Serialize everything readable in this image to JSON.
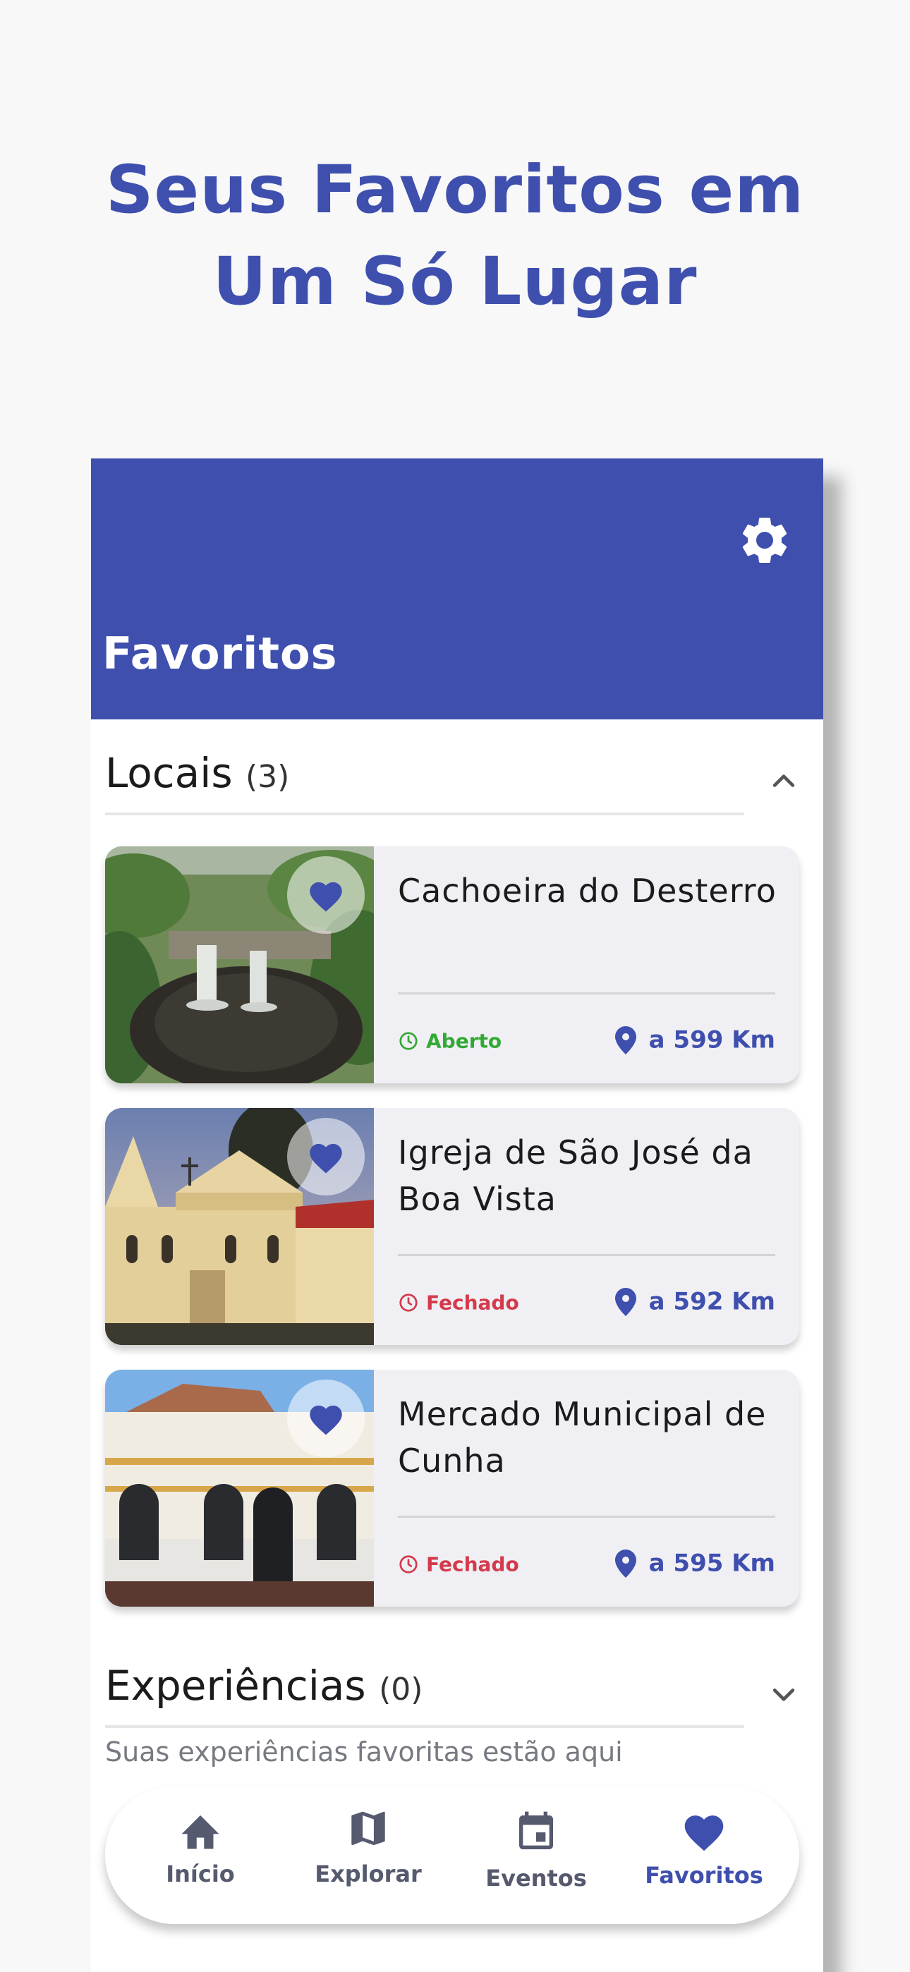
{
  "headline": {
    "line1": "Seus Favoritos em",
    "line2": "Um Só Lugar"
  },
  "app": {
    "title": "Favoritos",
    "settings_icon": "gear-icon"
  },
  "sections": {
    "locais": {
      "title": "Locais",
      "count": "(3)",
      "state": "expanded"
    },
    "experiencias": {
      "title": "Experiências",
      "count": "(0)",
      "state": "collapsed",
      "subtitle": "Suas experiências favoritas estão aqui"
    }
  },
  "places": [
    {
      "name": "Cachoeira do Desterro",
      "status": "Aberto",
      "distance": "a 599 Km"
    },
    {
      "name": "Igreja de São José da Boa Vista",
      "status": "Fechado",
      "distance": "a 592 Km"
    },
    {
      "name": "Mercado Municipal de Cunha",
      "status": "Fechado",
      "distance": "a 595 Km"
    }
  ],
  "nav": [
    {
      "label": "Início",
      "icon": "home-icon"
    },
    {
      "label": "Explorar",
      "icon": "map-icon"
    },
    {
      "label": "Eventos",
      "icon": "calendar-icon"
    },
    {
      "label": "Favoritos",
      "icon": "heart-icon",
      "active": true
    }
  ],
  "colors": {
    "primary": "#3f4fae",
    "open": "#33a935",
    "closed": "#d43a4c"
  }
}
